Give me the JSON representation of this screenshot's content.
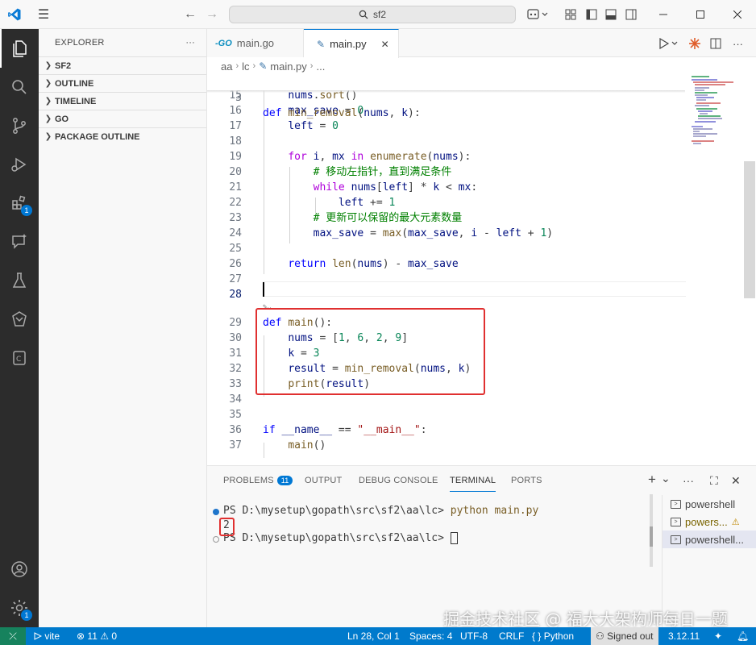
{
  "titlebar": {
    "search_text": "sf2",
    "nav_back": "←",
    "nav_forward": "→"
  },
  "activity_bar": {
    "items": [
      {
        "name": "explorer"
      },
      {
        "name": "search"
      },
      {
        "name": "source-control"
      },
      {
        "name": "run-and-debug"
      },
      {
        "name": "extensions",
        "badge": "1"
      },
      {
        "name": "remote-explorer"
      },
      {
        "name": "testing"
      },
      {
        "name": "copilot"
      },
      {
        "name": "remote-container"
      }
    ],
    "accounts_name": "accounts",
    "manage_badge": "1"
  },
  "sidebar": {
    "title": "EXPLORER",
    "more": "···",
    "sections": [
      "SF2",
      "OUTLINE",
      "TIMELINE",
      "GO",
      "PACKAGE OUTLINE"
    ]
  },
  "tabs": [
    {
      "label": "main.go",
      "icon_text": "-GO",
      "active": false
    },
    {
      "label": "main.py",
      "icon_text": "✎",
      "active": true,
      "close": "✕"
    }
  ],
  "breadcrumb": {
    "items": [
      "aa",
      "lc",
      "main.py",
      "..."
    ],
    "sep": "›"
  },
  "editor": {
    "sticky": {
      "num": "3",
      "html": "def min_removal(nums, k):"
    },
    "lines": [
      {
        "num": "15",
        "text": "    nums.sort()"
      },
      {
        "num": "16",
        "text": "    max_save = 0"
      },
      {
        "num": "17",
        "text": "    left = 0"
      },
      {
        "num": "18",
        "text": ""
      },
      {
        "num": "19",
        "text": "    for i, mx in enumerate(nums):"
      },
      {
        "num": "20",
        "text": "        # 移动左指针，直到满足条件"
      },
      {
        "num": "21",
        "text": "        while nums[left] * k < mx:"
      },
      {
        "num": "22",
        "text": "            left += 1"
      },
      {
        "num": "23",
        "text": "        # 更新可以保留的最大元素数量"
      },
      {
        "num": "24",
        "text": "        max_save = max(max_save, i - left + 1)"
      },
      {
        "num": "25",
        "text": ""
      },
      {
        "num": "26",
        "text": "    return len(nums) - max_save"
      },
      {
        "num": "27",
        "text": ""
      },
      {
        "num": "28",
        "text": ""
      },
      {
        "num": "29",
        "text": "def main():"
      },
      {
        "num": "30",
        "text": "    nums = [1, 6, 2, 9]"
      },
      {
        "num": "31",
        "text": "    k = 3"
      },
      {
        "num": "32",
        "text": "    result = min_removal(nums, k)"
      },
      {
        "num": "33",
        "text": "    print(result)"
      },
      {
        "num": "34",
        "text": ""
      },
      {
        "num": "35",
        "text": ""
      },
      {
        "num": "36",
        "text": "if __name__ == \"__main__\":"
      },
      {
        "num": "37",
        "text": "    main()"
      }
    ],
    "current_line": "28"
  },
  "panel": {
    "tabs": [
      {
        "label": "PROBLEMS",
        "badge": "11"
      },
      {
        "label": "OUTPUT"
      },
      {
        "label": "DEBUG CONSOLE"
      },
      {
        "label": "TERMINAL",
        "active": true
      },
      {
        "label": "PORTS"
      }
    ],
    "actions": [
      "+",
      "⌄",
      "···",
      "⛶",
      "✕"
    ],
    "terminal": {
      "prompt1": "PS D:\\mysetup\\gopath\\src\\sf2\\aa\\lc> ",
      "command": "python main.py",
      "output": "2",
      "prompt2": "PS D:\\mysetup\\gopath\\src\\sf2\\aa\\lc> "
    },
    "terminal_list": [
      {
        "label": "powershell"
      },
      {
        "label": "powers...",
        "warning": "⚠"
      },
      {
        "label": "powershell..."
      }
    ]
  },
  "statusbar": {
    "remote": "⤫",
    "vite": "vite",
    "errors": "11",
    "warnings": "0",
    "position": "Ln 28, Col 1",
    "spaces": "Spaces: 4",
    "encoding": "UTF-8",
    "eol": "CRLF",
    "language": "Python",
    "language_prefix": "{ }",
    "signed": "Signed out",
    "version": "3.12.11"
  },
  "watermark": "掘金技术社区 @ 福大大架构师每日一题",
  "colors": {
    "accent": "#0078d4",
    "statusbar": "#007acc",
    "highlight_box": "#e03030"
  }
}
